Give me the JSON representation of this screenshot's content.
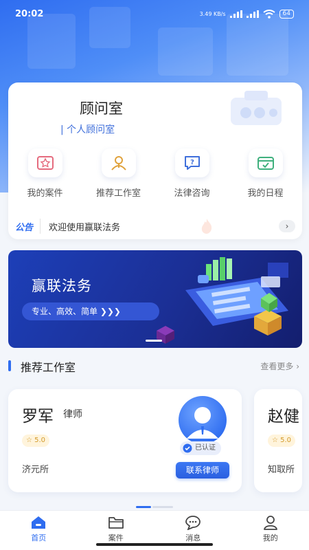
{
  "status_bar": {
    "time": "20:02",
    "network_speed": "3.49 KB/s",
    "battery": "64"
  },
  "office": {
    "title": "顾问室",
    "subtitle": "| 个人顾问室"
  },
  "quick_actions": [
    {
      "label": "我的案件",
      "icon": "case-icon"
    },
    {
      "label": "推荐工作室",
      "icon": "lawyer-icon"
    },
    {
      "label": "法律咨询",
      "icon": "consult-icon"
    },
    {
      "label": "我的日程",
      "icon": "calendar-icon"
    }
  ],
  "notice": {
    "tag": "公告",
    "text": "欢迎使用赢联法务",
    "arrow": "›"
  },
  "banner": {
    "title": "赢联法务",
    "tagline": "专业、高效、简单  ❯❯❯"
  },
  "section": {
    "title": "推荐工作室",
    "more": "查看更多 ›"
  },
  "studios": [
    {
      "name": "罗军",
      "role": "律师",
      "rating": "☆ 5.0",
      "firm": "济元所",
      "verified": "已认证",
      "contact": "联系律师"
    },
    {
      "name": "赵健",
      "role": "",
      "rating": "☆ 5.0",
      "firm": "知取所",
      "verified": "",
      "contact": ""
    }
  ],
  "tabbar": [
    {
      "label": "首页",
      "icon": "home-icon",
      "active": true
    },
    {
      "label": "案件",
      "icon": "folder-icon",
      "active": false
    },
    {
      "label": "消息",
      "icon": "message-icon",
      "active": false
    },
    {
      "label": "我的",
      "icon": "profile-icon",
      "active": false
    }
  ],
  "colors": {
    "accent": "#2f6df0",
    "banner_dark": "#1b2f95",
    "rating_bg": "#fff4dc"
  }
}
